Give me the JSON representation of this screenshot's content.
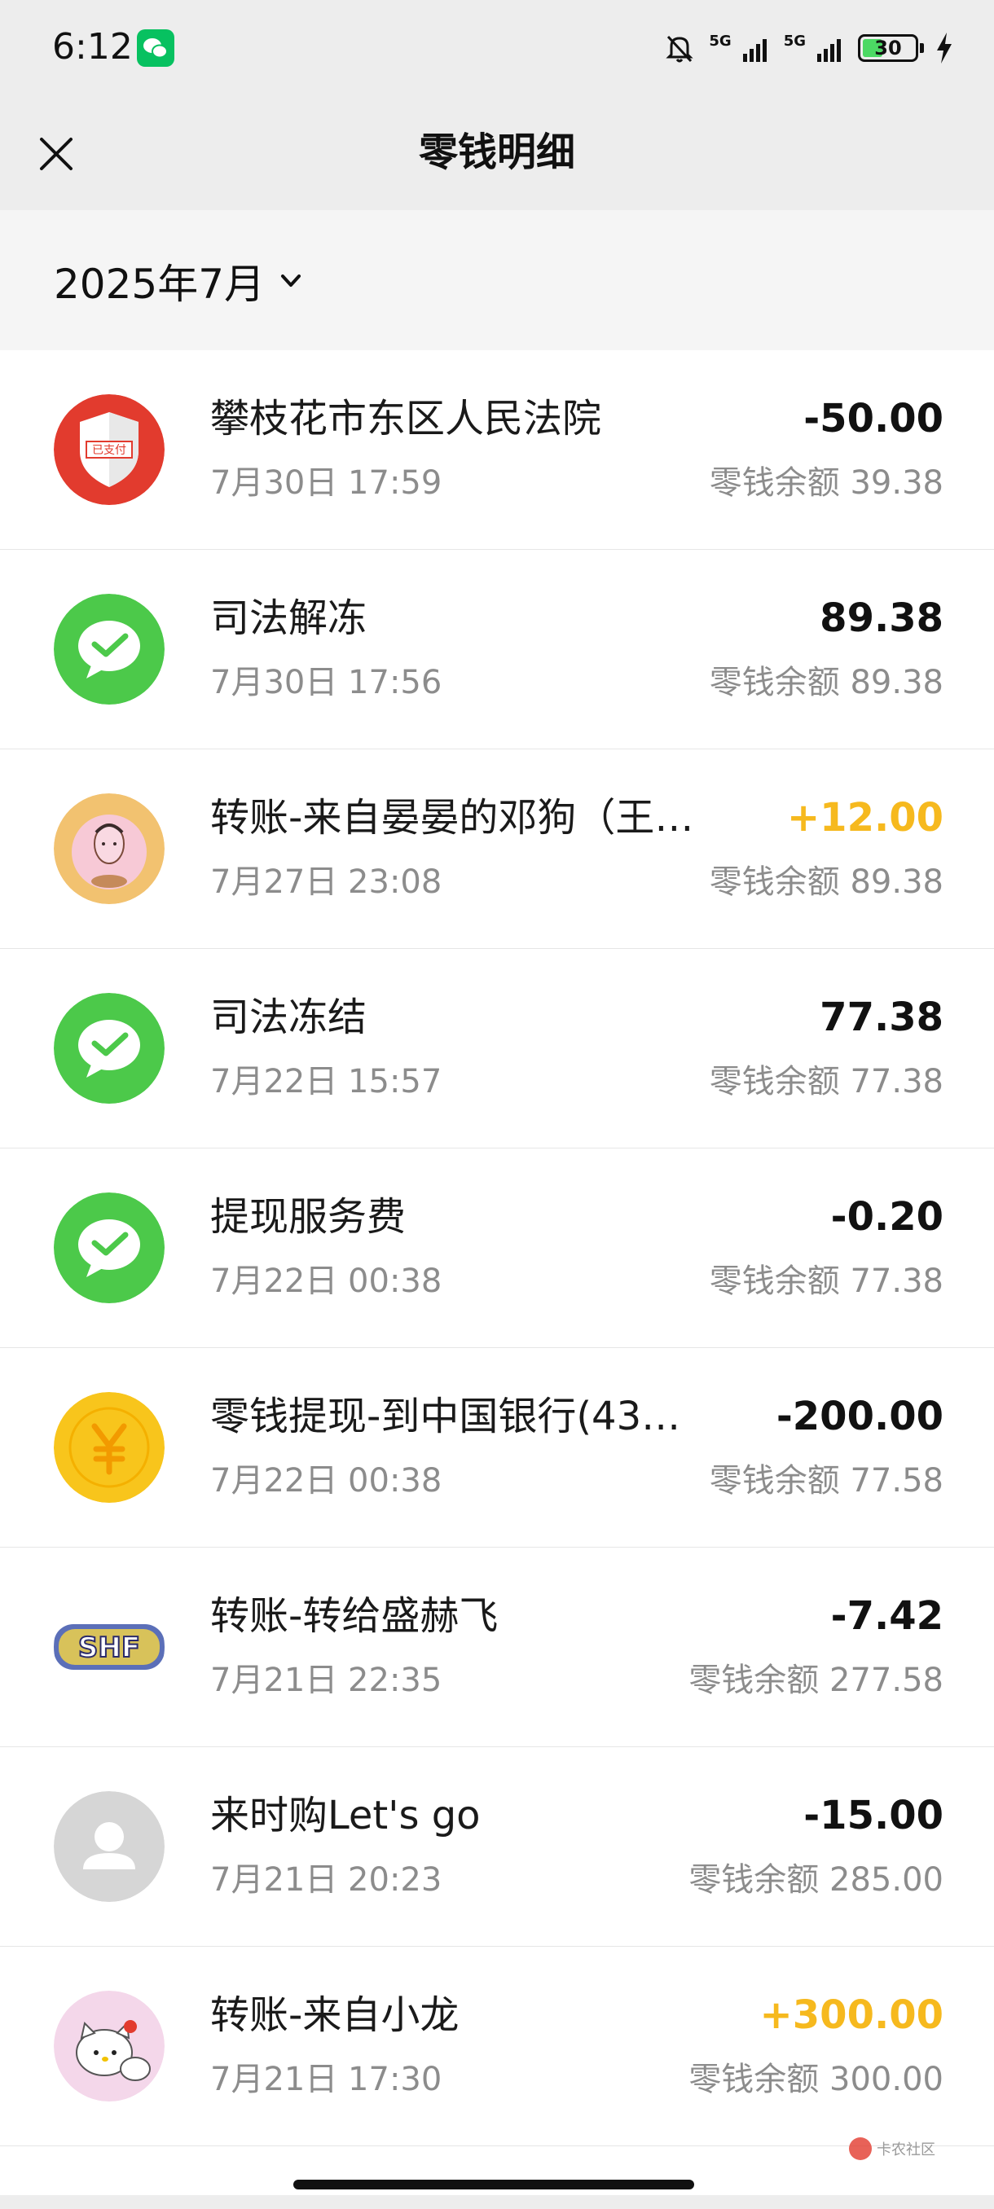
{
  "status_bar": {
    "time": "6:12",
    "network_1": "5G",
    "network_2": "5G",
    "battery": "30"
  },
  "nav": {
    "title": "零钱明细"
  },
  "filter": {
    "month": "2025年7月"
  },
  "transactions": [
    {
      "title": "攀枝花市东区人民法院",
      "date": "7月30日 17:59",
      "amount": "-50.00",
      "balance": "零钱余额 39.38",
      "avatar": "payment-shield-icon"
    },
    {
      "title": "司法解冻",
      "date": "7月30日 17:56",
      "amount": "89.38",
      "balance": "零钱余额 89.38",
      "avatar": "wechat-pay-icon"
    },
    {
      "title": "转账-来自晏晏的邓狗（王…",
      "date": "7月27日 23:08",
      "amount": "+12.00",
      "balance": "零钱余额 89.38",
      "avatar": "user-avatar"
    },
    {
      "title": "司法冻结",
      "date": "7月22日 15:57",
      "amount": "77.38",
      "balance": "零钱余额 77.38",
      "avatar": "wechat-pay-icon"
    },
    {
      "title": "提现服务费",
      "date": "7月22日 00:38",
      "amount": "-0.20",
      "balance": "零钱余额 77.38",
      "avatar": "wechat-pay-icon"
    },
    {
      "title": "零钱提现-到中国银行(43…",
      "date": "7月22日 00:38",
      "amount": "-200.00",
      "balance": "零钱余额 77.58",
      "avatar": "yuan-coin-icon"
    },
    {
      "title": "转账-转给盛赫飞",
      "date": "7月21日 22:35",
      "amount": "-7.42",
      "balance": "零钱余额 277.58",
      "avatar": "shf-avatar"
    },
    {
      "title": "来时购Let's go",
      "date": "7月21日 20:23",
      "amount": "-15.00",
      "balance": "零钱余额 285.00",
      "avatar": "default-avatar"
    },
    {
      "title": "转账-来自小龙",
      "date": "7月21日 17:30",
      "amount": "+300.00",
      "balance": "零钱余额 300.00",
      "avatar": "hello-kitty-avatar"
    }
  ],
  "watermark": {
    "text": "卡农社区"
  },
  "colors": {
    "background": "#ededed",
    "income": "#f6b91e",
    "wechat_green": "#07c160",
    "secondary_text": "#8c8c8c"
  }
}
